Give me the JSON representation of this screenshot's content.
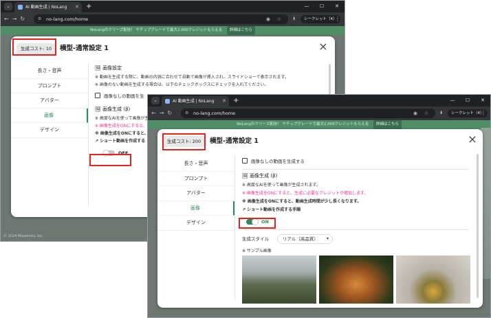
{
  "browser": {
    "tab_title": "AI 動画生成 | NoLang",
    "url": "no-lang.com/home",
    "incognito_label": "シークレット（4）",
    "banner_text": "NoLangのクリーズ配信！ ヤチップグレードで最大2,000クレジットもらえる",
    "banner_button": "詳細はこちら",
    "footer_text": "© 2024 Mavericks, Inc."
  },
  "modal_title": "横型-通常設定 1",
  "close_icon": "×",
  "nav_items": [
    "長さ・音声",
    "プロンプト",
    "アバター",
    "画像",
    "デザイン"
  ],
  "active_nav": "画像",
  "image_settings": {
    "heading": "画像設定",
    "line1": "※ 動画を生成する際に、動画の内容に合わせて自動で画像が挿入され、スライドショーで表示されます。",
    "line2": "※ 画像のない動画を生成する場合は、以下のチェックボックスにチェックを入れてください。",
    "checkbox_label": "画像なしの動画を生成する"
  },
  "image_gen": {
    "heading": "画像生成 (β)",
    "line1": "※ 高度なAIを使って画像が生成されます。",
    "line2": "※ 画像生成をONにすると、生成に必要なクレジットが増加します。",
    "line3": "※ 画像生成をONにすると、動画生成時間が少し長くなります。",
    "link": "ショート動画を作成する手順"
  },
  "window1": {
    "cost_label": "生成コスト: 10",
    "line1_short": "※ 高度なAIを使って画像が生",
    "line2_short": "※ 画像生成をONにすると、",
    "line3_short": "※ 画像生成をONにすると、",
    "link_short": "ショート動画を作成する",
    "checkbox_short": "画像なしの動画を生",
    "toggle_state": "OFF"
  },
  "window2": {
    "cost_label": "生成コスト: 200",
    "toggle_state": "ON",
    "style_label": "生成スタイル",
    "style_value": "リアル（高品質）",
    "sample_label": "※ サンプル画像"
  },
  "colors": {
    "accent": "#2a8a5c",
    "highlight": "#e8201c",
    "pink": "#e8338f"
  }
}
